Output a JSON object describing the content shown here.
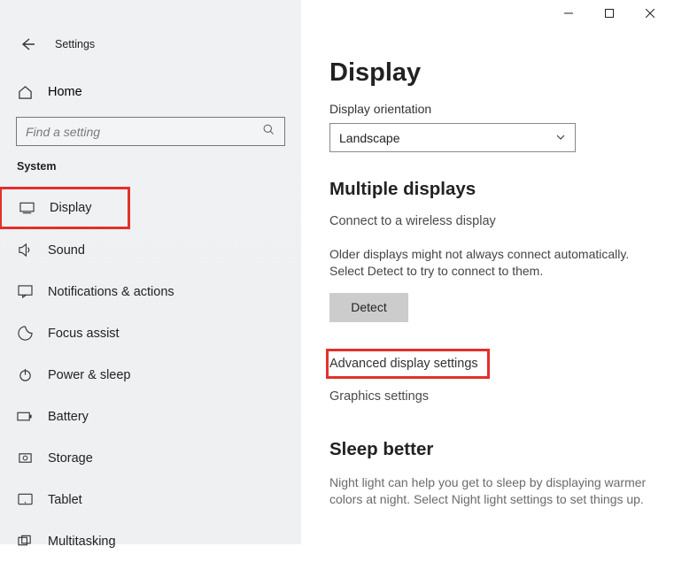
{
  "window": {
    "title": "Settings"
  },
  "sidebar": {
    "home_label": "Home",
    "search_placeholder": "Find a setting",
    "category": "System",
    "items": [
      {
        "label": "Display"
      },
      {
        "label": "Sound"
      },
      {
        "label": "Notifications & actions"
      },
      {
        "label": "Focus assist"
      },
      {
        "label": "Power & sleep"
      },
      {
        "label": "Battery"
      },
      {
        "label": "Storage"
      },
      {
        "label": "Tablet"
      },
      {
        "label": "Multitasking"
      }
    ]
  },
  "main": {
    "title": "Display",
    "orientation_label": "Display orientation",
    "orientation_value": "Landscape",
    "multi_header": "Multiple displays",
    "connect_wireless": "Connect to a wireless display",
    "older_text": "Older displays might not always connect automatically. Select Detect to try to connect to them.",
    "detect_label": "Detect",
    "advanced_label": "Advanced display settings",
    "graphics_label": "Graphics settings",
    "sleep_header": "Sleep better",
    "sleep_text": "Night light can help you get to sleep by displaying warmer colors at night. Select Night light settings to set things up."
  }
}
